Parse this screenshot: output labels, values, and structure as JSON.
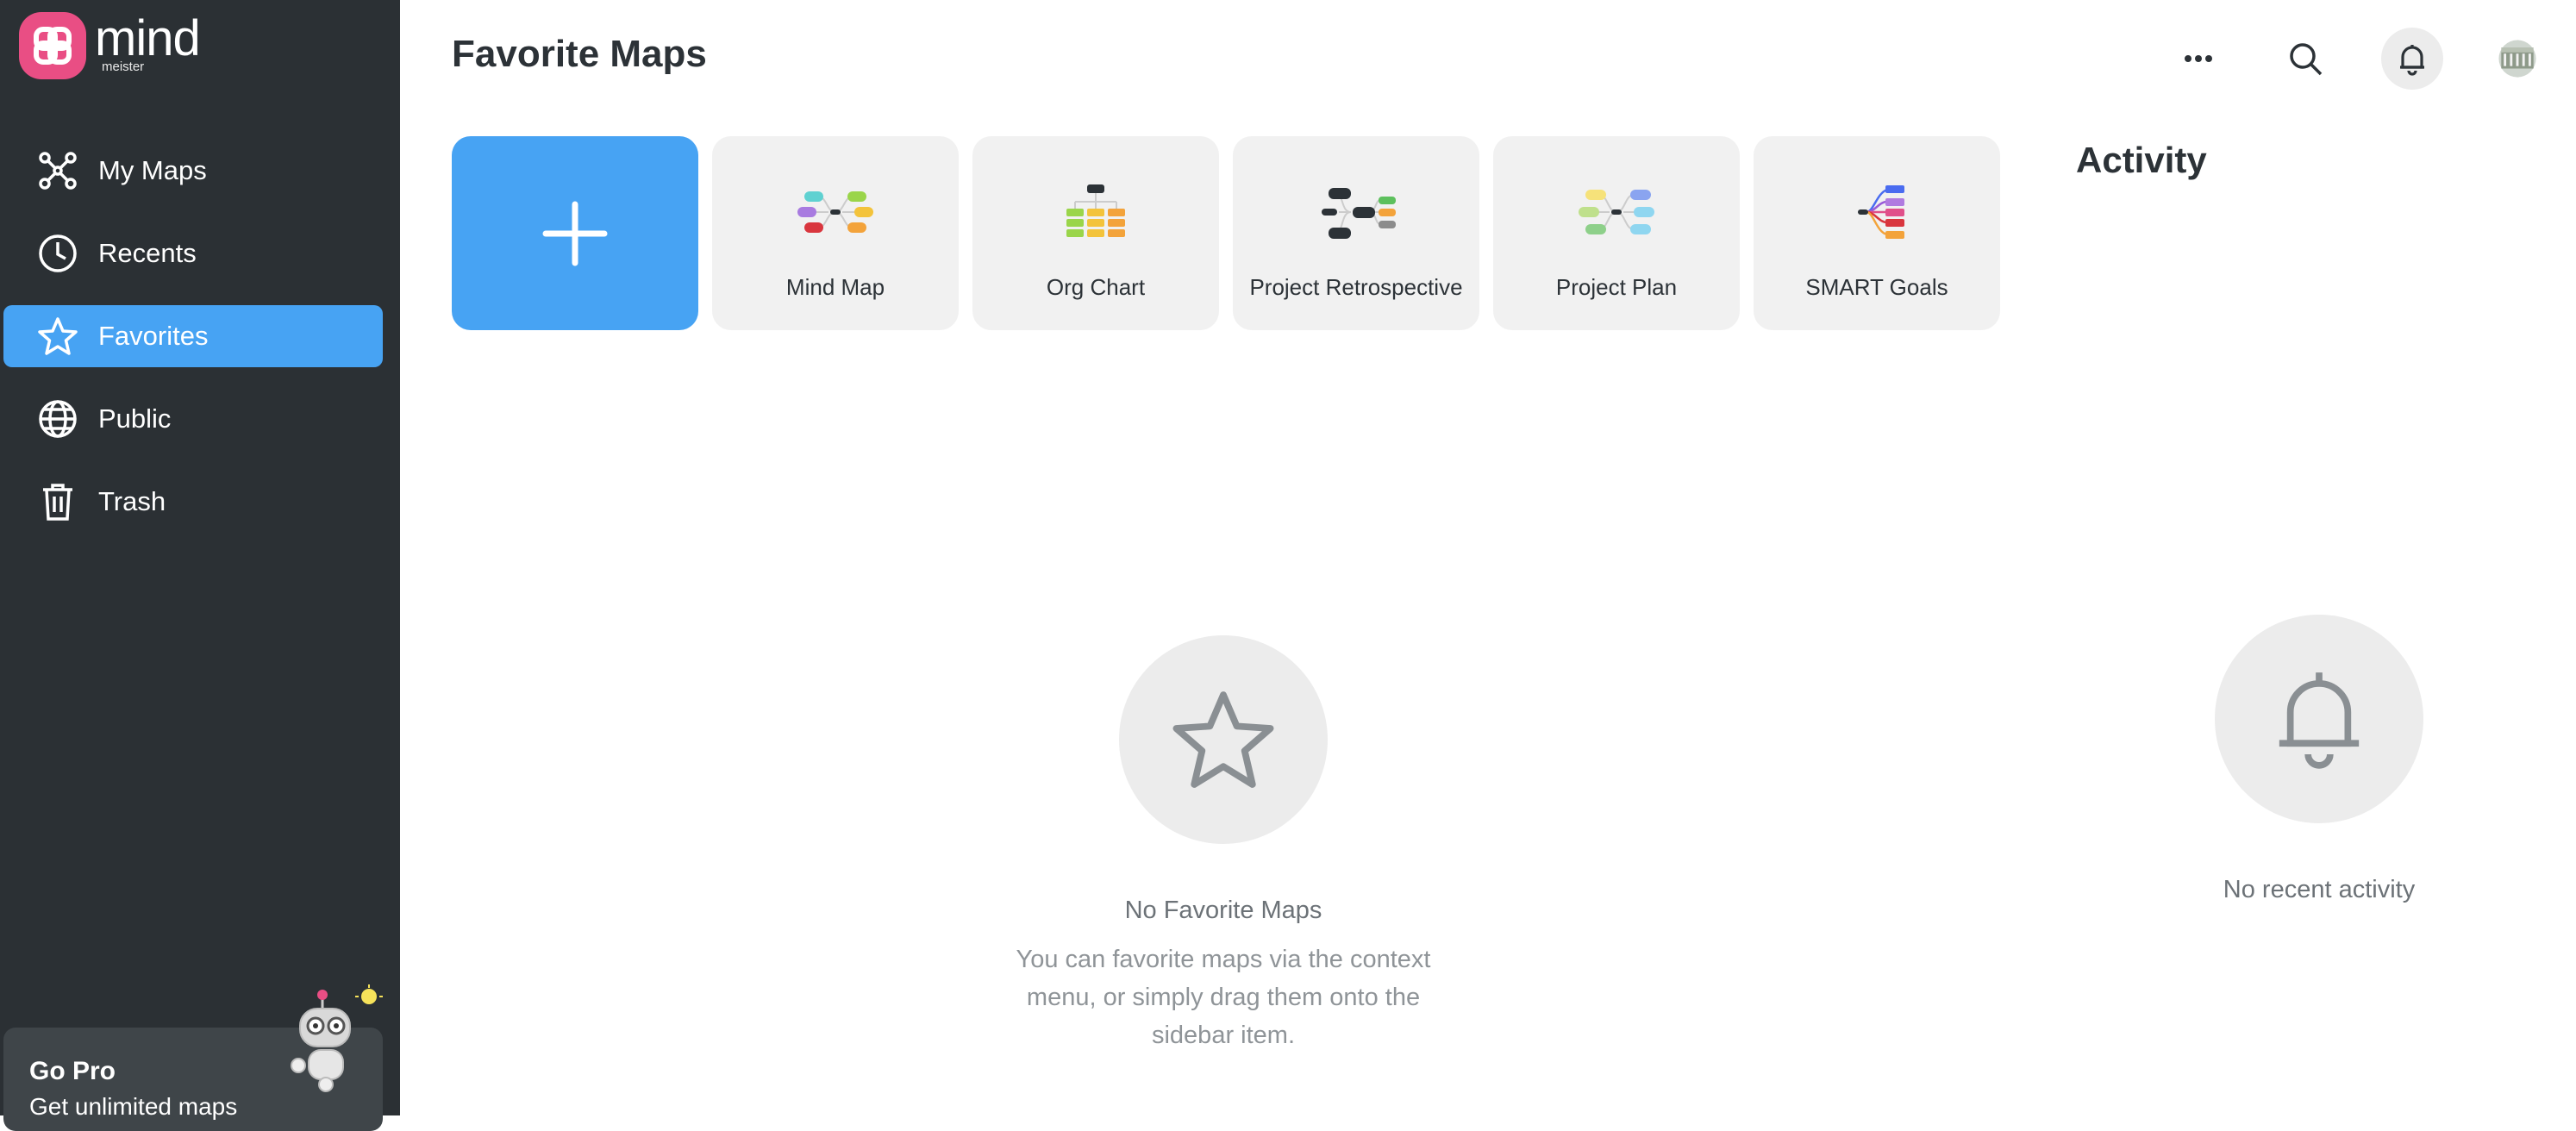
{
  "app": {
    "logo_word": "mind",
    "logo_sub": "meister"
  },
  "sidebar": {
    "items": [
      {
        "label": "My Maps",
        "icon": "my-maps-icon"
      },
      {
        "label": "Recents",
        "icon": "clock-icon"
      },
      {
        "label": "Favorites",
        "icon": "star-icon",
        "active": true
      },
      {
        "label": "Public",
        "icon": "globe-icon"
      },
      {
        "label": "Trash",
        "icon": "trash-icon"
      }
    ],
    "gopro": {
      "title": "Go Pro",
      "subtitle": "Get unlimited maps"
    }
  },
  "header": {
    "title": "Favorite Maps"
  },
  "templates": [
    {
      "label": "Mind Map",
      "icon": "mind-map-template-icon"
    },
    {
      "label": "Org Chart",
      "icon": "org-chart-template-icon"
    },
    {
      "label": "Project Retrospective",
      "icon": "retrospective-template-icon"
    },
    {
      "label": "Project Plan",
      "icon": "project-plan-template-icon"
    },
    {
      "label": "SMART Goals",
      "icon": "smart-goals-template-icon"
    }
  ],
  "empty_favorites": {
    "title": "No Favorite Maps",
    "text_line1": "You can favorite maps via the context",
    "text_line2": "menu, or simply drag them onto the",
    "text_line3": "sidebar item."
  },
  "activity": {
    "title": "Activity",
    "empty_text": "No recent activity"
  },
  "colors": {
    "accent": "#47a3f3",
    "sidebar_bg": "#2b3034",
    "brand": "#e94e84"
  }
}
